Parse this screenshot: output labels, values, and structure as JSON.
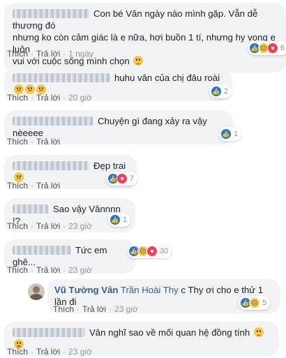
{
  "actions": {
    "like": "Thích",
    "reply": "Trả lời",
    "separator": "·"
  },
  "comments": [
    {
      "line1": "Con bé Vân ngày nào mình gặp. Vẫn dễ thương đó",
      "line2": "nhưng ko còn cảm giác là e nữa, hơi buồn 1 tí, nhưng hy vọng e luôn",
      "line3": "vui với cuộc sống mình chọn",
      "time": "1 ngày",
      "reactions": [
        "like",
        "sad",
        "love"
      ],
      "count": "6"
    },
    {
      "text": "huhu vân của chị đâu roài",
      "time": "20 giờ",
      "reactions": [
        "like"
      ],
      "count": "2"
    },
    {
      "text": "Chuyện gì đang xảy ra vậy nèeeee",
      "time": "",
      "reactions": [
        "like"
      ],
      "count": "1"
    },
    {
      "text": "Đẹp trai",
      "time": "",
      "reactions": [
        "like",
        "love"
      ],
      "count": "7"
    },
    {
      "text": "Sao vậy Vânnnn !?",
      "time": "23 giờ",
      "reactions": [
        "like"
      ],
      "count": "1"
    },
    {
      "text": "Tức em ghê...",
      "time": "23 giờ",
      "reactions": [
        "like",
        "sad",
        "love"
      ],
      "count": "30"
    },
    {
      "author": "Vũ Tường Vân",
      "tag": "Trần Hoài Thy",
      "text": "c Thy ơi cho e thử 1 lần đi",
      "time": "23 giờ",
      "reactions": [
        "like",
        "sad"
      ],
      "count": "5"
    },
    {
      "text": "Vân nghĩ sao về mối quan hệ đồng tính",
      "time": "23 giờ"
    }
  ]
}
